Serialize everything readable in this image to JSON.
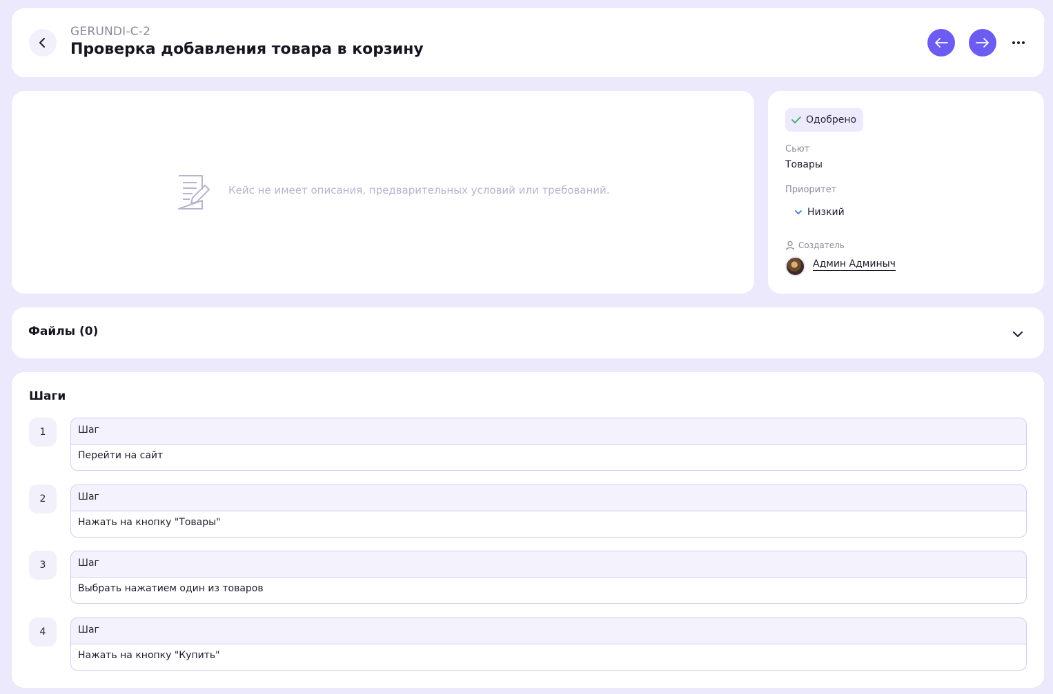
{
  "header": {
    "case_id": "GERUNDI-C-2",
    "title": "Проверка добавления товара в корзину",
    "back_icon": "chevron-left-icon",
    "prev_icon": "arrow-left-icon",
    "next_icon": "arrow-right-icon",
    "more_icon": "more-horizontal-icon",
    "accent_color": "#6c5cf2"
  },
  "description": {
    "empty_text": "Кейс не имеет описания, предварительных условий или требований.",
    "icon": "document-edit-icon"
  },
  "side": {
    "status": "Одобрено",
    "status_icon": "check-icon",
    "status_color": "#2eae5e",
    "suite_label": "Сьют",
    "suite_value": "Товары",
    "priority_label": "Приоритет",
    "priority_value": "Низкий",
    "priority_icon": "chevron-down-icon",
    "creator_label": "Создатель",
    "creator_name": "Админ Админыч"
  },
  "files": {
    "title": "Файлы (0)"
  },
  "steps": {
    "title": "Шаги",
    "items": [
      {
        "number": "1",
        "header": "Шаг",
        "text": "Перейти на сайт"
      },
      {
        "number": "2",
        "header": "Шаг",
        "text": "Нажать на кнопку \"Товары\""
      },
      {
        "number": "3",
        "header": "Шаг",
        "text": "Выбрать нажатием один из товаров"
      },
      {
        "number": "4",
        "header": "Шаг",
        "text": "Нажать на кнопку \"Купить\""
      }
    ]
  }
}
